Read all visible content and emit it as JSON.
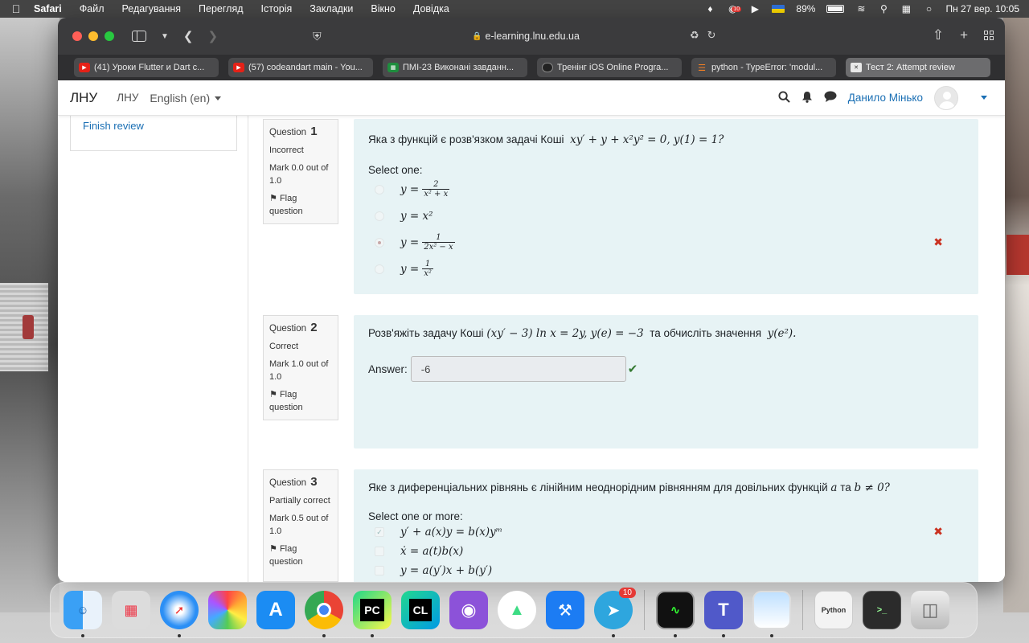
{
  "menubar": {
    "app": "Safari",
    "items": [
      "Файл",
      "Редагування",
      "Перегляд",
      "Історія",
      "Закладки",
      "Вікно",
      "Довідка"
    ],
    "notification_badge": "10",
    "battery": "89%",
    "datetime": "Пн 27 вер.  10:05"
  },
  "browser": {
    "url": "e-learning.lnu.edu.ua",
    "tabs": [
      {
        "label": "(41) Уроки Flutter и Dart c...",
        "favicon": "youtube-icon"
      },
      {
        "label": "(57) codeandart main - You...",
        "favicon": "youtube-icon"
      },
      {
        "label": "ПМІ-23 Виконані завданн...",
        "favicon": "sheets-icon"
      },
      {
        "label": "Тренінг iOS Online Progra...",
        "favicon": "training-icon"
      },
      {
        "label": "python - TypeError: 'modul...",
        "favicon": "stackoverflow-icon"
      },
      {
        "label": "Тест 2: Attempt review",
        "favicon": "moodle-icon",
        "active": true
      }
    ]
  },
  "navbar": {
    "brand": "ЛНУ",
    "link": "ЛНУ",
    "language": "English (en)",
    "user": "Данило Мінько"
  },
  "sidebar": {
    "finish_review": "Finish review"
  },
  "questions": [
    {
      "label": "Question",
      "number": "1",
      "state": "Incorrect",
      "mark": "Mark 0.0 out of 1.0",
      "flag": "Flag question",
      "text": "Яка з функцій є розв'язком задачі Коші",
      "equation": "xy′ + y + x²y² = 0,   y(1) = 1?",
      "select_label": "Select one:",
      "options": [
        {
          "lhs": "y =",
          "num": "2",
          "den": "x² + x"
        },
        {
          "lhs": "y = x²"
        },
        {
          "lhs": "y =",
          "num": "1",
          "den": "2x² − x"
        },
        {
          "lhs": "y =",
          "num": "1",
          "den": "x²"
        }
      ],
      "selected_index": 2,
      "result_icon": "✖"
    },
    {
      "label": "Question",
      "number": "2",
      "state": "Correct",
      "mark": "Mark 1.0 out of 1.0",
      "flag": "Flag question",
      "text_before": "Розв'яжіть задачу Коші",
      "equation": "(xy′ − 3) ln x = 2y,   y(e) = −3",
      "text_after": "та обчисліть значення",
      "target": "y(e²).",
      "answer_label": "Answer:",
      "answer_value": "-6",
      "result_icon": "✔"
    },
    {
      "label": "Question",
      "number": "3",
      "state": "Partially correct",
      "mark": "Mark 0.5 out of 1.0",
      "flag": "Flag question",
      "text": "Яке з диференціальних рівнянь є лінійним неоднорідним рівнянням для довільних функцій",
      "var_a": "a",
      "and": "та",
      "cond": "b ≠ 0?",
      "select_label": "Select one or more:",
      "options": [
        {
          "eq": "y′ + a(x)y = b(x)yᵐ",
          "checked": true,
          "result_icon": "✖"
        },
        {
          "eq": "ẋ = a(t)b(x)"
        },
        {
          "eq": "y = a(y′)x + b(y′)"
        }
      ]
    }
  ],
  "dock": {
    "badge": "10",
    "apps": [
      "finder-icon",
      "launchpad-icon",
      "safari-icon",
      "photos-icon",
      "app-store-icon",
      "chrome-icon",
      "pycharm-icon",
      "clion-icon",
      "github-desktop-icon",
      "android-studio-icon",
      "xcode-icon",
      "telegram-icon",
      "activity-monitor-icon",
      "teams-icon",
      "preview-icon",
      "python-doc-icon",
      "terminal-icon",
      "trash-icon"
    ]
  }
}
